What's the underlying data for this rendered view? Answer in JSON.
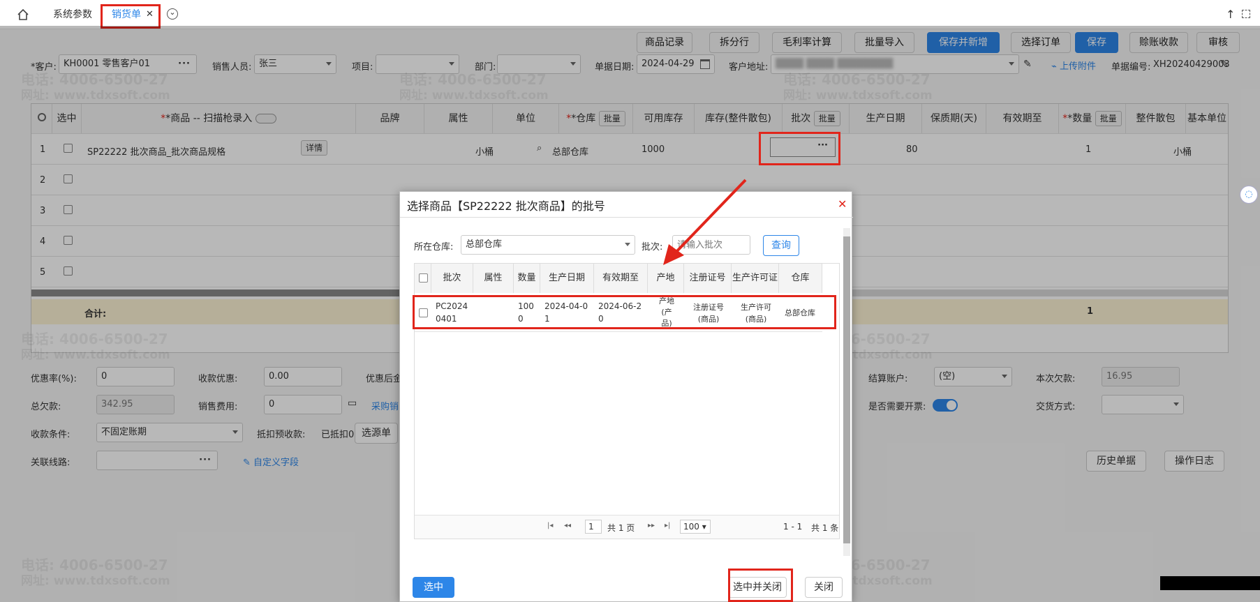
{
  "tabs": {
    "home_icon": "home-icon",
    "items": [
      {
        "label": "系统参数"
      },
      {
        "label": "销货单",
        "active": true
      }
    ],
    "close_glyph": "✕",
    "more_glyph": "⌄"
  },
  "toolbar": {
    "buttons": [
      "商品记录",
      "拆分行",
      "毛利率计算",
      "批量导入",
      "保存并新增",
      "选择订单",
      "保存",
      "赊账收款",
      "审核"
    ]
  },
  "header_form": {
    "customer_label": "*客户:",
    "customer_value": "KH0001 零售客户01",
    "salesperson_label": "销售人员:",
    "salesperson_value": "张三",
    "project_label": "项目:",
    "project_value": "",
    "department_label": "部门:",
    "department_value": "",
    "date_label": "单据日期:",
    "date_value": "2024-04-29",
    "address_label": "客户地址:",
    "address_value": "████ ████ ████████",
    "upload_label": "上传附件",
    "docno_label": "单据编号:",
    "docno_value": "XH20240429003"
  },
  "grid": {
    "headers": [
      "选中",
      "*商品 -- 扫描枪录入",
      "品牌",
      "属性",
      "单位",
      "*仓库",
      "可用库存",
      "库存(整件散包)",
      "批次",
      "生产日期",
      "保质期(天)",
      "有效期至",
      "*数量",
      "整件散包",
      "基本单位"
    ],
    "batch_button": "批量",
    "row1": {
      "no": "1",
      "product": "SP22222 批次商品_批次商品规格",
      "detail": "详情",
      "unit": "小桶",
      "warehouse": "总部仓库",
      "available": "1000",
      "shelf_life": "80",
      "qty": "1",
      "base_unit": "小桶"
    },
    "row_numbers": [
      "1",
      "2",
      "3",
      "4",
      "5"
    ],
    "total_label": "合计:",
    "total_qty": "1"
  },
  "bottom_form": {
    "discount_rate_label": "优惠率(%):",
    "discount_rate_value": "0",
    "discount_amount_label": "收款优惠:",
    "discount_amount_value": "0.00",
    "after_discount_label": "优惠后金",
    "settle_account_label": "结算账户:",
    "settle_account_value": "(空)",
    "current_debt_label": "本次欠款:",
    "current_debt_value": "16.95",
    "total_debt_label": "总欠款:",
    "total_debt_value": "342.95",
    "sales_fee_label": "销售费用:",
    "sales_fee_value": "0",
    "purchase_link": "采购销",
    "invoice_label": "是否需要开票:",
    "trade_mode_label": "交货方式:",
    "payment_terms_label": "收款条件:",
    "payment_terms_value": "不固定账期",
    "prepay_label": "抵扣预收款:",
    "prepay_value": "已抵扣0",
    "select_doc_button": "选源单",
    "route_label": "关联线路:",
    "custom_field_link": "自定义字段",
    "history_button": "历史单据",
    "oplog_button": "操作日志"
  },
  "dialog": {
    "title": "选择商品【SP22222 批次商品】的批号",
    "warehouse_label": "所在仓库:",
    "warehouse_value": "总部仓库",
    "batch_label": "批次:",
    "batch_placeholder": "请输入批次",
    "query_button": "查询",
    "headers": [
      "批次",
      "属性",
      "数量",
      "生产日期",
      "有效期至",
      "产地",
      "注册证号",
      "生产许可证",
      "仓库"
    ],
    "row": {
      "batch": "PC2024 0401",
      "attr": "",
      "qty": "100 0",
      "prod_date": "2024-04-0 1",
      "expiry": "2024-06-2 0",
      "origin": "产地 (产 品)",
      "reg_no": "注册证号 (商品)",
      "license": "生产许可 (商品)",
      "warehouse": "总部仓库"
    },
    "pager": {
      "first": "|◂",
      "prev": "◂◂",
      "page": "1",
      "total_pages": "共 1 页",
      "next": "▸▸",
      "last": "▸|",
      "page_size": "100",
      "range": "1 - 1",
      "total": "共 1 条"
    },
    "select_button": "选中",
    "select_close_button": "选中并关闭",
    "close_button": "关闭"
  },
  "watermark": {
    "phone": "电话: 4006-6500-27",
    "site": "网址: www.tdxsoft.com"
  },
  "colors": {
    "accent": "#2d86e8",
    "highlight": "#e1251b",
    "total_row": "#fdf3d5"
  }
}
